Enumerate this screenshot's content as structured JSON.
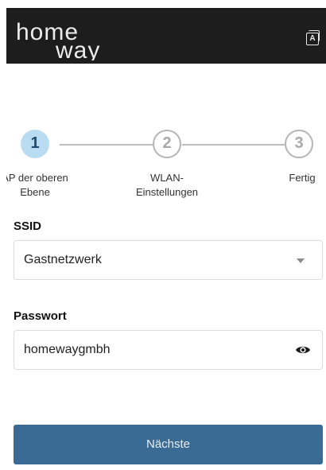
{
  "header": {
    "logo_line1": "home",
    "logo_line2": "way",
    "lang_icon_letter": "A"
  },
  "stepper": {
    "steps": [
      {
        "number": "1",
        "label": "AP der oberen Ebene",
        "state": "active"
      },
      {
        "number": "2",
        "label": "WLAN-\nEinstellungen",
        "state": "inactive"
      },
      {
        "number": "3",
        "label": "Fertig",
        "state": "inactive"
      }
    ]
  },
  "form": {
    "ssid_label": "SSID",
    "ssid_value": "Gastnetzwerk",
    "password_label": "Passwort",
    "password_value": "homewaygmbh"
  },
  "actions": {
    "next_label": "Nächste"
  },
  "colors": {
    "header_bg": "#1d1d1d",
    "active_step": "#b9dcf3",
    "primary_button": "#3a6b94"
  }
}
